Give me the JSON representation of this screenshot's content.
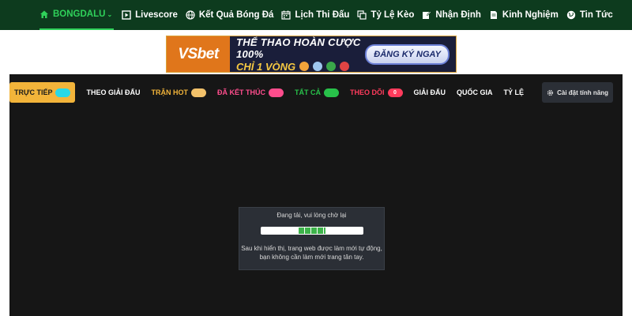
{
  "nav": {
    "brand": "BONGDALU",
    "items": [
      {
        "label": "Livescore",
        "icon": "play-box-icon"
      },
      {
        "label": "Kết Quả Bóng Đá",
        "icon": "globe-icon"
      },
      {
        "label": "Lịch Thi Đấu",
        "icon": "calendar-icon"
      },
      {
        "label": "Tỷ Lệ Kèo",
        "icon": "copy-icon"
      },
      {
        "label": "Nhận Định",
        "icon": "edit-icon"
      },
      {
        "label": "Kinh Nghiệm",
        "icon": "document-icon"
      },
      {
        "label": "Tin Tức",
        "icon": "globe-icon"
      }
    ],
    "colors": {
      "bg": "#0d3b1e",
      "brand": "#2fd15a"
    }
  },
  "banner": {
    "logo_vs": "VS",
    "logo_bet": "bet",
    "line1": "THỂ THAO HOÀN CƯỢC 100%",
    "line2": "CHỈ 1 VÒNG",
    "cta": "ĐĂNG KÝ NGAY"
  },
  "filters": [
    {
      "label": "TRỰC TIẾP",
      "color": "#1b1b1b",
      "pill": "#27d8e6",
      "active": true
    },
    {
      "label": "THEO GIẢI ĐẤU",
      "color": "#ffffff",
      "pill": null
    },
    {
      "label": "TRẬN HOT",
      "color": "#f2b43a",
      "pill": "#f2c16a"
    },
    {
      "label": "ĐÃ KẾT THÚC",
      "color": "#ff4d8d",
      "pill": "#ff4d8d"
    },
    {
      "label": "TẤT CẢ",
      "color": "#28c14a",
      "pill": "#28c14a"
    },
    {
      "label": "THEO DÕI",
      "color": "#ff3b5c",
      "pill": "#ff3b5c",
      "pill_text": "0"
    },
    {
      "label": "GIẢI ĐẤU",
      "color": "#ffffff",
      "pill": null
    },
    {
      "label": "QUỐC GIA",
      "color": "#ffffff",
      "pill": null
    },
    {
      "label": "TỶ LỆ",
      "color": "#ffffff",
      "pill": null
    }
  ],
  "settings": {
    "label": "Cài đặt tính năng",
    "icon": "gear-icon"
  },
  "loading": {
    "title": "Đang tải, vui lòng chờ lại",
    "progress_percent": 27,
    "note_line1": "Sau khi hiển thị, trang web được làm mới tự động,",
    "note_line2": "bạn không cần làm mới trang tân tay."
  }
}
